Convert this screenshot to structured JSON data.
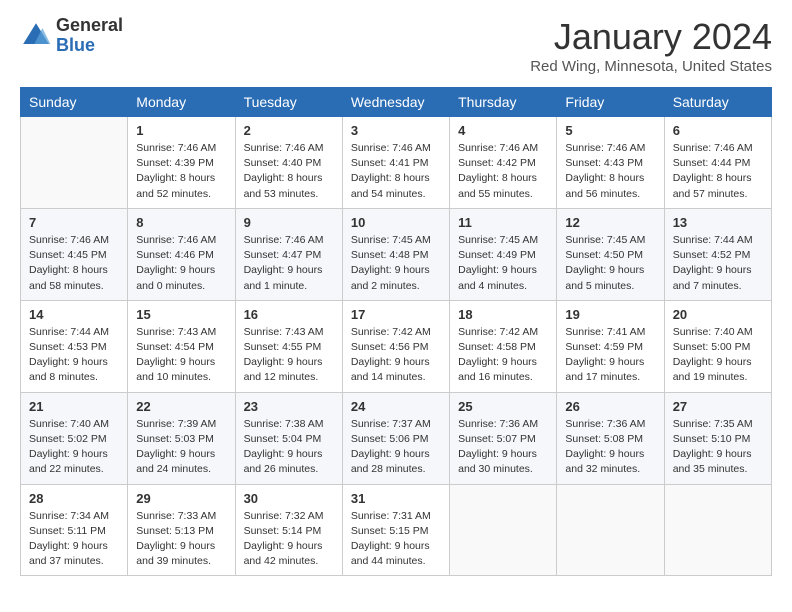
{
  "header": {
    "logo_general": "General",
    "logo_blue": "Blue",
    "month_title": "January 2024",
    "location": "Red Wing, Minnesota, United States"
  },
  "weekdays": [
    "Sunday",
    "Monday",
    "Tuesday",
    "Wednesday",
    "Thursday",
    "Friday",
    "Saturday"
  ],
  "weeks": [
    [
      {
        "day": "",
        "sunrise": "",
        "sunset": "",
        "daylight": ""
      },
      {
        "day": "1",
        "sunrise": "Sunrise: 7:46 AM",
        "sunset": "Sunset: 4:39 PM",
        "daylight": "Daylight: 8 hours and 52 minutes."
      },
      {
        "day": "2",
        "sunrise": "Sunrise: 7:46 AM",
        "sunset": "Sunset: 4:40 PM",
        "daylight": "Daylight: 8 hours and 53 minutes."
      },
      {
        "day": "3",
        "sunrise": "Sunrise: 7:46 AM",
        "sunset": "Sunset: 4:41 PM",
        "daylight": "Daylight: 8 hours and 54 minutes."
      },
      {
        "day": "4",
        "sunrise": "Sunrise: 7:46 AM",
        "sunset": "Sunset: 4:42 PM",
        "daylight": "Daylight: 8 hours and 55 minutes."
      },
      {
        "day": "5",
        "sunrise": "Sunrise: 7:46 AM",
        "sunset": "Sunset: 4:43 PM",
        "daylight": "Daylight: 8 hours and 56 minutes."
      },
      {
        "day": "6",
        "sunrise": "Sunrise: 7:46 AM",
        "sunset": "Sunset: 4:44 PM",
        "daylight": "Daylight: 8 hours and 57 minutes."
      }
    ],
    [
      {
        "day": "7",
        "sunrise": "Sunrise: 7:46 AM",
        "sunset": "Sunset: 4:45 PM",
        "daylight": "Daylight: 8 hours and 58 minutes."
      },
      {
        "day": "8",
        "sunrise": "Sunrise: 7:46 AM",
        "sunset": "Sunset: 4:46 PM",
        "daylight": "Daylight: 9 hours and 0 minutes."
      },
      {
        "day": "9",
        "sunrise": "Sunrise: 7:46 AM",
        "sunset": "Sunset: 4:47 PM",
        "daylight": "Daylight: 9 hours and 1 minute."
      },
      {
        "day": "10",
        "sunrise": "Sunrise: 7:45 AM",
        "sunset": "Sunset: 4:48 PM",
        "daylight": "Daylight: 9 hours and 2 minutes."
      },
      {
        "day": "11",
        "sunrise": "Sunrise: 7:45 AM",
        "sunset": "Sunset: 4:49 PM",
        "daylight": "Daylight: 9 hours and 4 minutes."
      },
      {
        "day": "12",
        "sunrise": "Sunrise: 7:45 AM",
        "sunset": "Sunset: 4:50 PM",
        "daylight": "Daylight: 9 hours and 5 minutes."
      },
      {
        "day": "13",
        "sunrise": "Sunrise: 7:44 AM",
        "sunset": "Sunset: 4:52 PM",
        "daylight": "Daylight: 9 hours and 7 minutes."
      }
    ],
    [
      {
        "day": "14",
        "sunrise": "Sunrise: 7:44 AM",
        "sunset": "Sunset: 4:53 PM",
        "daylight": "Daylight: 9 hours and 8 minutes."
      },
      {
        "day": "15",
        "sunrise": "Sunrise: 7:43 AM",
        "sunset": "Sunset: 4:54 PM",
        "daylight": "Daylight: 9 hours and 10 minutes."
      },
      {
        "day": "16",
        "sunrise": "Sunrise: 7:43 AM",
        "sunset": "Sunset: 4:55 PM",
        "daylight": "Daylight: 9 hours and 12 minutes."
      },
      {
        "day": "17",
        "sunrise": "Sunrise: 7:42 AM",
        "sunset": "Sunset: 4:56 PM",
        "daylight": "Daylight: 9 hours and 14 minutes."
      },
      {
        "day": "18",
        "sunrise": "Sunrise: 7:42 AM",
        "sunset": "Sunset: 4:58 PM",
        "daylight": "Daylight: 9 hours and 16 minutes."
      },
      {
        "day": "19",
        "sunrise": "Sunrise: 7:41 AM",
        "sunset": "Sunset: 4:59 PM",
        "daylight": "Daylight: 9 hours and 17 minutes."
      },
      {
        "day": "20",
        "sunrise": "Sunrise: 7:40 AM",
        "sunset": "Sunset: 5:00 PM",
        "daylight": "Daylight: 9 hours and 19 minutes."
      }
    ],
    [
      {
        "day": "21",
        "sunrise": "Sunrise: 7:40 AM",
        "sunset": "Sunset: 5:02 PM",
        "daylight": "Daylight: 9 hours and 22 minutes."
      },
      {
        "day": "22",
        "sunrise": "Sunrise: 7:39 AM",
        "sunset": "Sunset: 5:03 PM",
        "daylight": "Daylight: 9 hours and 24 minutes."
      },
      {
        "day": "23",
        "sunrise": "Sunrise: 7:38 AM",
        "sunset": "Sunset: 5:04 PM",
        "daylight": "Daylight: 9 hours and 26 minutes."
      },
      {
        "day": "24",
        "sunrise": "Sunrise: 7:37 AM",
        "sunset": "Sunset: 5:06 PM",
        "daylight": "Daylight: 9 hours and 28 minutes."
      },
      {
        "day": "25",
        "sunrise": "Sunrise: 7:36 AM",
        "sunset": "Sunset: 5:07 PM",
        "daylight": "Daylight: 9 hours and 30 minutes."
      },
      {
        "day": "26",
        "sunrise": "Sunrise: 7:36 AM",
        "sunset": "Sunset: 5:08 PM",
        "daylight": "Daylight: 9 hours and 32 minutes."
      },
      {
        "day": "27",
        "sunrise": "Sunrise: 7:35 AM",
        "sunset": "Sunset: 5:10 PM",
        "daylight": "Daylight: 9 hours and 35 minutes."
      }
    ],
    [
      {
        "day": "28",
        "sunrise": "Sunrise: 7:34 AM",
        "sunset": "Sunset: 5:11 PM",
        "daylight": "Daylight: 9 hours and 37 minutes."
      },
      {
        "day": "29",
        "sunrise": "Sunrise: 7:33 AM",
        "sunset": "Sunset: 5:13 PM",
        "daylight": "Daylight: 9 hours and 39 minutes."
      },
      {
        "day": "30",
        "sunrise": "Sunrise: 7:32 AM",
        "sunset": "Sunset: 5:14 PM",
        "daylight": "Daylight: 9 hours and 42 minutes."
      },
      {
        "day": "31",
        "sunrise": "Sunrise: 7:31 AM",
        "sunset": "Sunset: 5:15 PM",
        "daylight": "Daylight: 9 hours and 44 minutes."
      },
      {
        "day": "",
        "sunrise": "",
        "sunset": "",
        "daylight": ""
      },
      {
        "day": "",
        "sunrise": "",
        "sunset": "",
        "daylight": ""
      },
      {
        "day": "",
        "sunrise": "",
        "sunset": "",
        "daylight": ""
      }
    ]
  ]
}
